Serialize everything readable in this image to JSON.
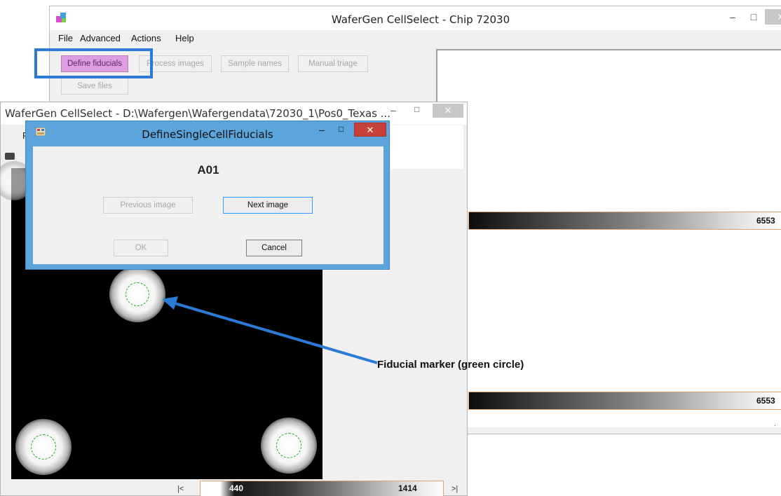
{
  "main_window": {
    "title": "WaferGen CellSelect - Chip 72030",
    "controls": {
      "minimize": "–",
      "maximize": "□",
      "close": "✕"
    },
    "menu": [
      "File",
      "Advanced",
      "Actions",
      "Help"
    ],
    "toolbar": {
      "define_fiducials": "Define fiducials",
      "process_images": "Process images",
      "sample_names": "Sample names",
      "manual_triage": "Manual triage",
      "save_files": "Save files"
    },
    "scale_top_max": "6553",
    "scale_bottom_max": "6553"
  },
  "image_window": {
    "title": "WaferGen CellSelect - D:\\Wafergen\\Wafergendata\\72030_1\\Pos0_Texas ...",
    "controls": {
      "minimize": "–",
      "maximize": "□",
      "close": "✕"
    },
    "menu_first_letter": "F",
    "nav_first": "|<",
    "nav_last": ">|",
    "scale_min": "440",
    "scale_max": "1414"
  },
  "dialog": {
    "title": "DefineSingleCellFiducials",
    "controls": {
      "minimize": "–",
      "maximize": "□",
      "close": "✕"
    },
    "well": "A01",
    "previous_image": "Previous image",
    "next_image": "Next image",
    "ok": "OK",
    "cancel": "Cancel"
  },
  "annotation": {
    "label": "Fiducial marker (green circle)",
    "arrow_color": "#2b7bd6"
  },
  "colors": {
    "highlight": "#2b7bd6",
    "define_button": "#dc9ee0",
    "dialog_border": "#5ba4dc",
    "dialog_close": "#c7413a",
    "fiducial_ring": "#1ea51e"
  },
  "icons": [
    "app-logo-icon",
    "dialog-app-icon",
    "printer-icon"
  ]
}
